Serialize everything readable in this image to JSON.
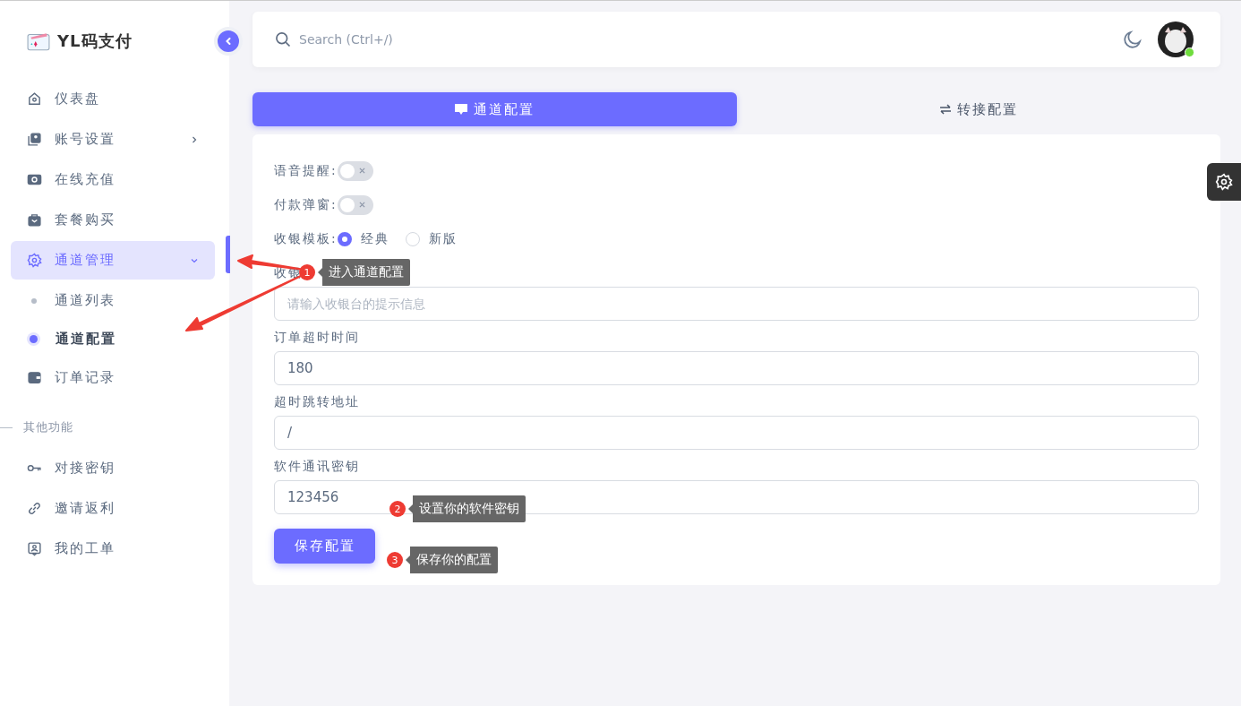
{
  "sidebar": {
    "logo_text": "YL码支付",
    "menu": [
      {
        "kind": "item",
        "label": "仪表盘"
      },
      {
        "kind": "group",
        "label": "账号设置",
        "expanded": false,
        "selected": false
      },
      {
        "kind": "item",
        "label": "在线充值"
      },
      {
        "kind": "item",
        "label": "套餐购买"
      },
      {
        "kind": "group",
        "label": "通道管理",
        "expanded": true,
        "selected": true,
        "children": [
          {
            "label": "通道列表",
            "selected": false
          },
          {
            "label": "通道配置",
            "selected": true
          }
        ]
      },
      {
        "kind": "item",
        "label": "订单记录"
      },
      {
        "kind": "section",
        "label": "其他功能"
      },
      {
        "kind": "item",
        "label": "对接密钥"
      },
      {
        "kind": "item",
        "label": "邀请返利"
      },
      {
        "kind": "item",
        "label": "我的工单"
      }
    ]
  },
  "header": {
    "search": {
      "placeholder": "Search (Ctrl+/)"
    },
    "avatar": {
      "online": true
    }
  },
  "tabs": [
    {
      "label": "通道配置",
      "selected": true
    },
    {
      "label": "转接配置",
      "selected": false
    }
  ],
  "form": {
    "switches": [
      {
        "label": "语音提醒:",
        "on": false
      },
      {
        "label": "付款弹窗:",
        "on": false
      }
    ],
    "radio": {
      "label": "收银模板:",
      "options": [
        {
          "label": "经典",
          "selected": true
        },
        {
          "label": "新版",
          "selected": false
        }
      ]
    },
    "fields": [
      {
        "label": "收银",
        "placeholder": "请输入收银台的提示信息"
      },
      {
        "label": "订单超时时间",
        "value": "180"
      },
      {
        "label": "超时跳转地址",
        "value": "/"
      },
      {
        "label": "软件通讯密钥",
        "value": "123456"
      }
    ],
    "save_button": "保存配置"
  },
  "annotations": [
    {
      "number": "1",
      "text": "进入通道配置"
    },
    {
      "number": "2",
      "text": "设置你的软件密钥"
    },
    {
      "number": "3",
      "text": "保存你的配置"
    }
  ]
}
